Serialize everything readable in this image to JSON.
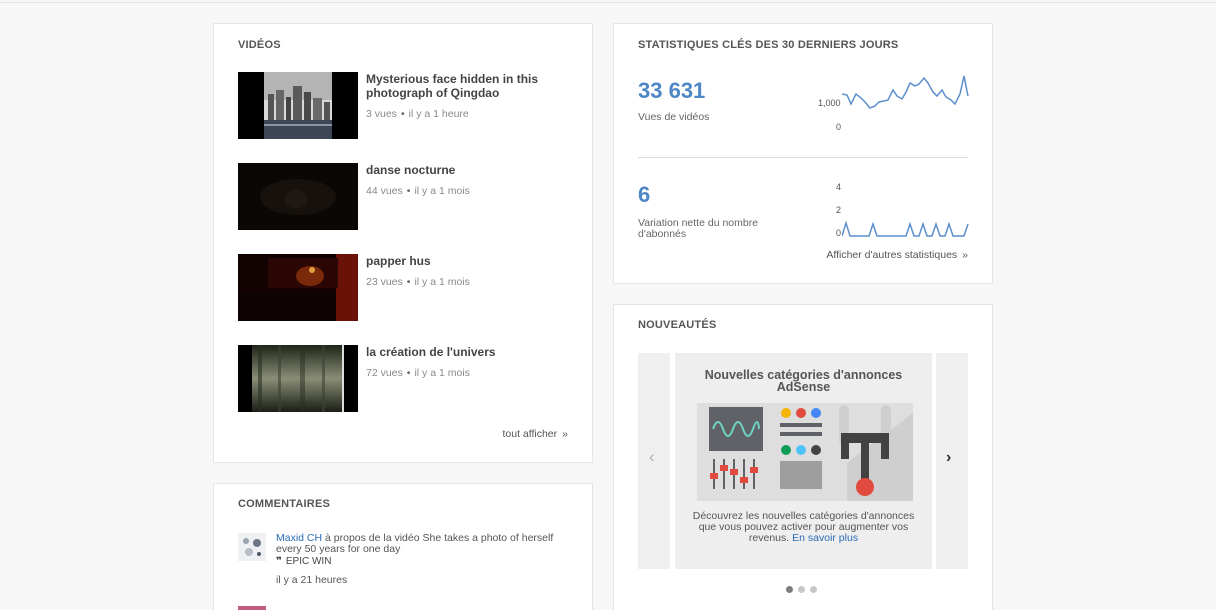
{
  "videos": {
    "title": "VIDÉOS",
    "items": [
      {
        "title": "Mysterious face hidden in this photograph of Qingdao",
        "views": "3 vues",
        "age": "il y a 1 heure"
      },
      {
        "title": "danse nocturne",
        "views": "44 vues",
        "age": "il y a 1 mois"
      },
      {
        "title": "papper hus",
        "views": "23 vues",
        "age": "il y a 1 mois"
      },
      {
        "title": "la création de l'univers",
        "views": "72 vues",
        "age": "il y a 1 mois"
      }
    ],
    "see_all": "tout afficher",
    "see_all_chevron": "»"
  },
  "comments": {
    "title": "COMMENTAIRES",
    "items": [
      {
        "author": "Maxid CH",
        "context": " à propos de la vidéo She takes a photo of herself every 50 years for one day",
        "quote_mark": "❞",
        "text": "EPIC WIN",
        "time": "il y a 21 heures"
      }
    ]
  },
  "stats": {
    "title": "STATISTIQUES CLÉS DES 30 DERNIERS JOURS",
    "views": {
      "value": "33 631",
      "label": "Vues de vidéos",
      "axis_top": "1,000",
      "axis_bottom": "0"
    },
    "subs": {
      "value": "6",
      "label": "Variation nette du nombre d'abonnés",
      "axis_top": "4",
      "axis_mid": "2",
      "axis_bottom": "0"
    },
    "more": "Afficher d'autres statistiques",
    "more_chevron": "»"
  },
  "news": {
    "title": "NOUVEAUTÉS",
    "slide_title": "Nouvelles catégories d'annonces AdSense",
    "slide_text": "Découvrez les nouvelles catégories d'annonces que vous pouvez activer pour augmenter vos revenus. ",
    "slide_link": "En savoir plus",
    "prev_arrow": "‹",
    "next_arrow": "›",
    "pages": 3,
    "active_page": 1
  },
  "colors": {
    "accent": "#4f86c6",
    "link": "#2a6db5"
  }
}
